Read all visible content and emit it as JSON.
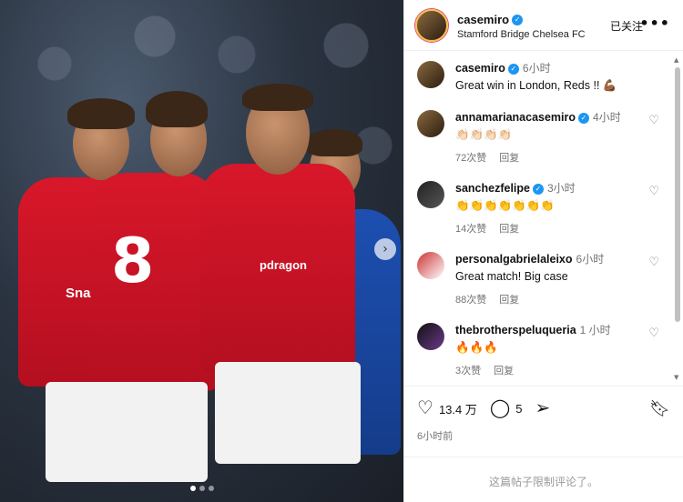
{
  "header": {
    "username": "casemiro",
    "location": "Stamford Bridge Chelsea FC",
    "following_label": "已关注",
    "more_label": "•••"
  },
  "photo": {
    "shirt_number": "8",
    "sponsor": "Snapdragon",
    "sponsor_partial": "Snapdr",
    "sponsor_partial2": "pdragon"
  },
  "comments": [
    {
      "user": "casemiro",
      "verified": true,
      "time": "6小时",
      "text": "Great win in London, Reds !! 💪🏾",
      "likes": "",
      "reply": ""
    },
    {
      "user": "annamarianacasemiro",
      "verified": true,
      "time": "4小时",
      "text": "👏🏻👏🏻👏🏻👏🏻",
      "likes": "72次赞",
      "reply": "回复"
    },
    {
      "user": "sanchezfelipe",
      "verified": true,
      "time": "3小时",
      "text": "👏👏👏👏👏👏👏",
      "likes": "14次赞",
      "reply": "回复"
    },
    {
      "user": "personalgabrielaleixo",
      "verified": false,
      "time": "6小时",
      "text": "Great match! Big case",
      "likes": "88次赞",
      "reply": "回复"
    },
    {
      "user": "thebrotherspeluqueria",
      "verified": false,
      "time": "1 小时",
      "text": "🔥🔥🔥",
      "likes": "3次赞",
      "reply": "回复"
    }
  ],
  "actions": {
    "likes_count": "13.4 万",
    "comments_count": "5",
    "post_time": "6小时前"
  },
  "footer": {
    "limited_text": "这篇帖子限制评论了。"
  },
  "icons": {
    "like": "heart-icon",
    "comment": "comment-icon",
    "share": "share-icon",
    "save": "bookmark-icon",
    "verified": "verified-badge-icon"
  },
  "colors": {
    "verified": "#1c96f0",
    "united_red": "#d8172a",
    "chelsea_blue": "#1d4fb1"
  }
}
